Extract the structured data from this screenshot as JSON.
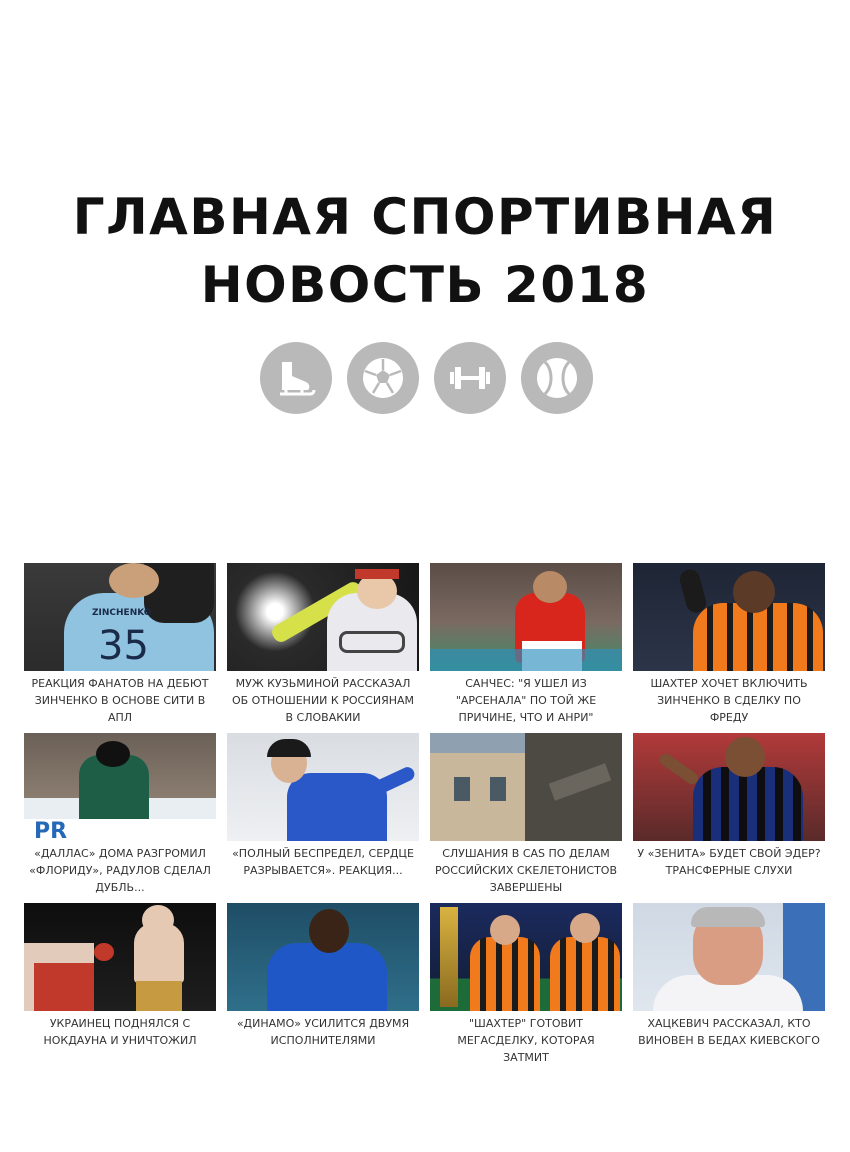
{
  "header": {
    "title_line1": "ГЛАВНАЯ СПОРТИВНАЯ",
    "title_line2": "НОВОСТЬ 2018"
  },
  "sport_icons": [
    {
      "name": "skate-icon"
    },
    {
      "name": "soccer-ball-icon"
    },
    {
      "name": "dumbbell-icon"
    },
    {
      "name": "tennis-ball-icon"
    }
  ],
  "colors": {
    "icon_bg": "#b9b9b9",
    "caption_text": "#333333"
  },
  "news": [
    {
      "caption": "РЕАКЦИЯ ФАНАТОВ НА ДЕБЮТ ЗИНЧЕНКО В ОСНОВЕ СИТИ В АПЛ",
      "jersey_name": "ZINCHENKO",
      "jersey_number": "35"
    },
    {
      "caption": "МУЖ КУЗЬМИНОЙ РАССКАЗАЛ ОБ ОТНОШЕНИИ К РОССИЯНАМ В СЛОВАКИИ"
    },
    {
      "caption": "САНЧЕС: \"Я УШЕЛ ИЗ \"АРСЕНАЛА\" ПО ТОЙ ЖЕ ПРИЧИНЕ, ЧТО И АНРИ\""
    },
    {
      "caption": "ШАХТЕР ХОЧЕТ ВКЛЮЧИТЬ ЗИНЧЕНКО В СДЕЛКУ ПО ФРЕДУ"
    },
    {
      "caption": "«ДАЛЛАС» ДОМА РАЗГРОМИЛ «ФЛОРИДУ», РАДУЛОВ СДЕЛАЛ ДУБЛЬ..."
    },
    {
      "caption": "«ПОЛНЫЙ БЕСПРЕДЕЛ, СЕРДЦЕ РАЗРЫВАЕТСЯ». РЕАКЦИЯ..."
    },
    {
      "caption": "СЛУШАНИЯ В CAS ПО ДЕЛАМ РОССИЙСКИХ СКЕЛЕТОНИСТОВ ЗАВЕРШЕНЫ"
    },
    {
      "caption": "У «ЗЕНИТА» БУДЕТ СВОЙ ЭДЕР? ТРАНСФЕРНЫЕ СЛУХИ"
    },
    {
      "caption": "УКРАИНЕЦ ПОДНЯЛСЯ С НОКДАУНА И УНИЧТОЖИЛ"
    },
    {
      "caption": "«ДИНАМО» УСИЛИТСЯ ДВУМЯ ИСПОЛНИТЕЛЯМИ"
    },
    {
      "caption": "\"ШАХТЕР\" ГОТОВИТ МЕГАСДЕЛКУ, КОТОРАЯ ЗАТМИТ"
    },
    {
      "caption": "ХАЦКЕВИЧ РАССКАЗАЛ, КТО ВИНОВЕН В БЕДАХ КИЕВСКОГО"
    }
  ]
}
